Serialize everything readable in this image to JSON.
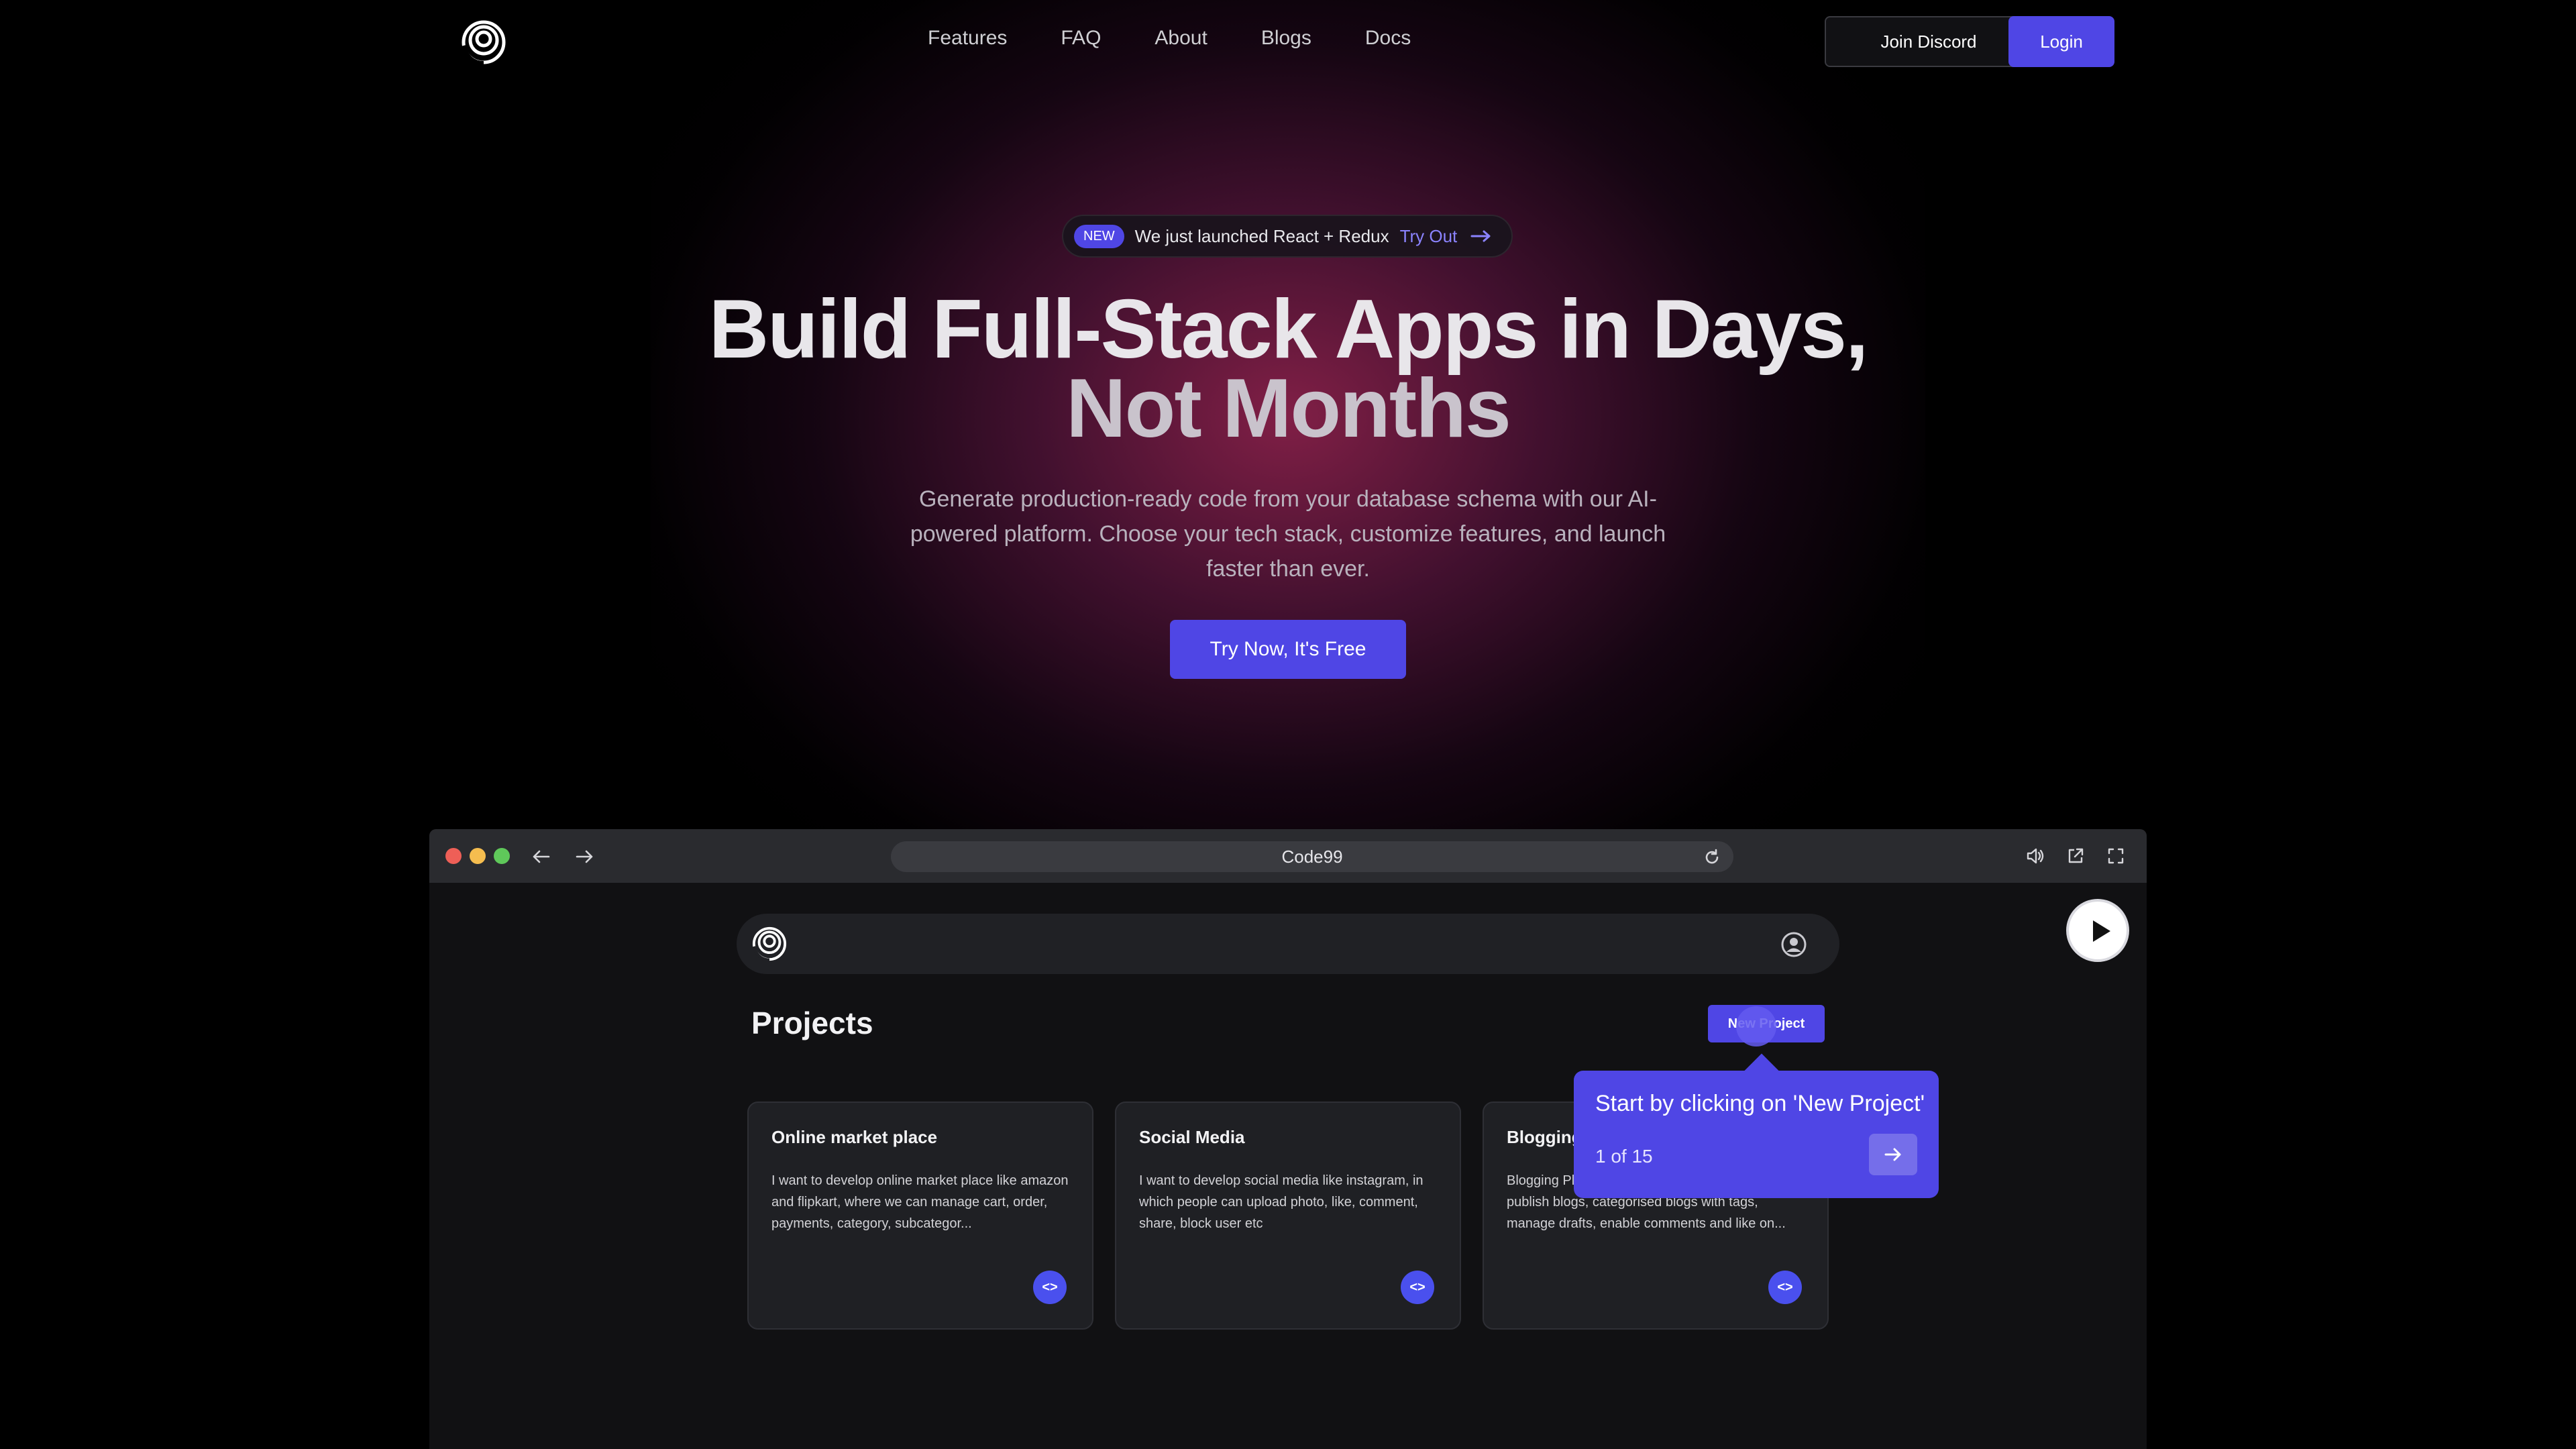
{
  "nav": {
    "links": [
      "Features",
      "FAQ",
      "About",
      "Blogs",
      "Docs"
    ],
    "join_discord": "Join Discord",
    "login": "Login"
  },
  "announcement": {
    "badge": "NEW",
    "text": "We just launched React + Redux",
    "link": "Try Out"
  },
  "hero": {
    "title_line1": "Build Full-Stack Apps in Days,",
    "title_line2": "Not Months",
    "subtitle": "Generate production-ready code from your database schema with our AI-powered platform. Choose your tech stack, customize features, and launch faster than ever.",
    "cta": "Try Now, It's Free"
  },
  "browser": {
    "url": "Code99"
  },
  "app": {
    "projects_title": "Projects",
    "new_project": "New Project",
    "cards": [
      {
        "title": "Online market place",
        "description": "I want to develop online market place like amazon and flipkart, where we can manage cart, order, payments, category, subcategor..."
      },
      {
        "title": "Social Media",
        "description": "I want to develop social media like instagram, in which people can upload photo, like, comment, share, block user etc"
      },
      {
        "title": "Blogging",
        "description": "Blogging Platform where users can create & publish blogs, categorised blogs with tags, manage drafts, enable comments and like on..."
      }
    ],
    "code_label": "<>"
  },
  "tour": {
    "text": "Start by clicking on 'New Project'",
    "step": "1 of 15"
  },
  "colors": {
    "accent": "#4f46e5",
    "background": "#000000",
    "glow": "#a5285a"
  },
  "icons": {
    "logo": "spiral-logo-icon",
    "announce_arrow": "arrow-right-icon",
    "back": "arrow-left-icon",
    "forward": "arrow-right-icon",
    "reload": "reload-icon",
    "volume": "volume-icon",
    "external": "external-link-icon",
    "fullscreen": "fullscreen-icon",
    "user": "user-circle-icon",
    "play": "play-icon",
    "tour_next": "arrow-right-icon"
  }
}
